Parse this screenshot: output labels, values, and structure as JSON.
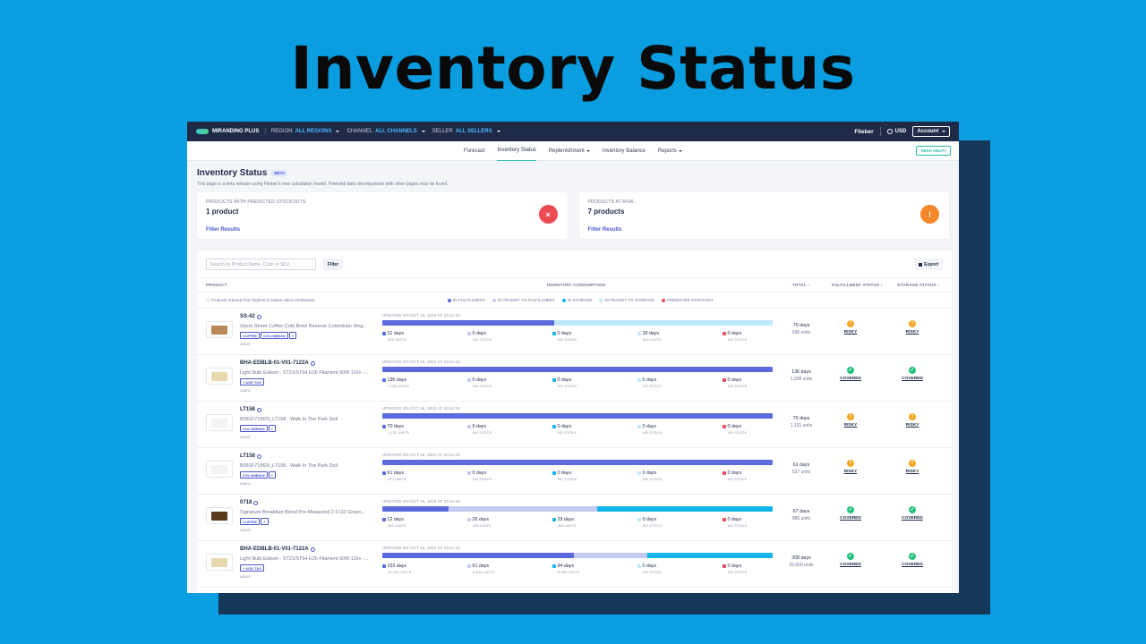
{
  "hero_title": "Inventory Status",
  "colors": {
    "in_fulfillment": "#5b6bde",
    "in_transit_to_fulfillment": "#c5caef",
    "in_storage": "#13b5ea",
    "in_transit_to_storage": "#bfe8fb",
    "predicted_stockout": "#e84a5f",
    "risky": "#f4a623",
    "covered": "#22c07a"
  },
  "topnav": {
    "brand": "MIRANDING PLUS",
    "region_label": "REGION",
    "region_value": "ALL REGIONS",
    "channel_label": "CHANNEL",
    "channel_value": "ALL CHANNELS",
    "seller_label": "SELLER",
    "seller_value": "ALL SELLERS",
    "user": "Flieber",
    "currency": "USD",
    "account": "Account"
  },
  "subnav": {
    "tabs": [
      "Forecast",
      "Inventory Status",
      "Replenishment",
      "Inventory Balance",
      "Reports"
    ],
    "help": "NEED HELP?"
  },
  "page": {
    "title": "Inventory Status",
    "beta": "BETA",
    "notice": "This page is a beta release using Flieber's new calculation model. Potential data discrepancies with other pages may be found."
  },
  "cards": [
    {
      "key": "PRODUCTS WITH PREDICTED STOCKOUTS",
      "value": "1 product",
      "link": "Filter Results",
      "icon": "close-icon",
      "icon_char": "×",
      "color": "#ee4a52"
    },
    {
      "key": "PRODUCTS AT RISK",
      "value": "7 products",
      "link": "Filter Results",
      "icon": "exclamation-icon",
      "icon_char": "!",
      "color": "#f5872b"
    }
  ],
  "toolbar": {
    "search_placeholder": "Search by Product Name, Code or SKU",
    "filter": "Filter",
    "export": "Export"
  },
  "table": {
    "headers": {
      "product": "PRODUCT",
      "consumption": "INVENTORY CONSUMPTION",
      "total": "TOTAL ↕",
      "fulfillment": "FULFILLMENT STATUS ↕",
      "storage": "STORAGE STATUS ↕"
    },
    "order_note": "Products ordered from highest to lowest sales contribution.",
    "legend": [
      "IN FULFILLMENT",
      "IN TRANSIT TO FULFILLMENT",
      "IN STORAGE",
      "IN TRANSIT TO STORAGE",
      "PREDICTED STOCKOUT"
    ],
    "rows": [
      {
        "sku": "SS-42",
        "name": "Stone Street Coffee Cold Brew Reserve Colombian Sing...",
        "tags": [
          "COFFEE",
          "COLOMBIAN",
          "+"
        ],
        "region": "AMUS",
        "updated": "UPDATED ON OCT 16, 2022 AT 23:41:24",
        "segments": [
          0.44,
          0,
          0,
          0.56
        ],
        "thumb_color": "#b88a5a",
        "stats": [
          {
            "days": "31 days",
            "units": "495 UNITS"
          },
          {
            "days": "0 days",
            "units": "NO STOCK"
          },
          {
            "days": "0 days",
            "units": "NO STOCK"
          },
          {
            "days": "39 days",
            "units": "504 UNITS"
          },
          {
            "days": "0 days",
            "units": "NO STOCK"
          }
        ],
        "total_days": "70 days",
        "total_units": "936 units",
        "fulfillment": "RISKY",
        "storage": "RISKY"
      },
      {
        "sku": "BHA-EDBLB-01-V01-7122A",
        "name": "Light Bulb Edison - ST21/ST64 E26 Filament 60W 110v -...",
        "tags": [
          "+ ADD TAG"
        ],
        "region": "AMEU",
        "updated": "UPDATED ON OCT 16, 2022 AT 23:41:22",
        "segments": [
          1,
          0,
          0,
          0
        ],
        "thumb_color": "#e7d8b0",
        "stats": [
          {
            "days": "136 days",
            "units": "1,038 UNITS"
          },
          {
            "days": "0 days",
            "units": "NO STOCK"
          },
          {
            "days": "0 days",
            "units": "NO STOCK"
          },
          {
            "days": "0 days",
            "units": "NO STOCK"
          },
          {
            "days": "0 days",
            "units": "NO STOCK"
          }
        ],
        "total_days": "136 days",
        "total_units": "1,038 units",
        "fulfillment": "COVERED",
        "storage": "COVERED"
      },
      {
        "sku": "LT158",
        "name": "B081F71M29_LT158 - Walk In The Park Doll",
        "tags": [
          "COLOMBIAN",
          "+"
        ],
        "region": "AMUS",
        "updated": "UPDATED ON OCT 16, 2022 AT 23:41:18",
        "segments": [
          1,
          0,
          0,
          0
        ],
        "thumb_color": "#f3f3f3",
        "stats": [
          {
            "days": "70 days",
            "units": "1,131 UNITS"
          },
          {
            "days": "0 days",
            "units": "NO STOCK"
          },
          {
            "days": "0 days",
            "units": "NO STOCK"
          },
          {
            "days": "0 days",
            "units": "NO STOCK"
          },
          {
            "days": "0 days",
            "units": "NO STOCK"
          }
        ],
        "total_days": "70 days",
        "total_units": "1,131 units",
        "fulfillment": "RISKY",
        "storage": "RISKY"
      },
      {
        "sku": "LT158",
        "name": "B081F71M29_LT158 - Walk In The Park Doll",
        "tags": [
          "COLOMBIAN",
          "+"
        ],
        "region": "AMEU",
        "updated": "UPDATED ON OCT 16, 2022 AT 23:41:18",
        "segments": [
          1,
          0,
          0,
          0
        ],
        "thumb_color": "#f3f3f3",
        "stats": [
          {
            "days": "61 days",
            "units": "527 UNITS"
          },
          {
            "days": "0 days",
            "units": "NO STOCK"
          },
          {
            "days": "0 days",
            "units": "NO STOCK"
          },
          {
            "days": "0 days",
            "units": "NO STOCK"
          },
          {
            "days": "0 days",
            "units": "NO STOCK"
          }
        ],
        "total_days": "61 days",
        "total_units": "527 units",
        "fulfillment": "RISKY",
        "storage": "RISKY"
      },
      {
        "sku": "0718",
        "name": "Signature Breakfast Blend Pre-Measured 2.5 OZ Groun...",
        "tags": [
          "COFFEE",
          "+"
        ],
        "region": "AMUS",
        "updated": "UPDATED ON OCT 16, 2022 AT 23:41:19",
        "segments": [
          0.17,
          0.38,
          0.45,
          0
        ],
        "thumb_color": "#5a3b1e",
        "stats": [
          {
            "days": "12 days",
            "units": "155 UNITS"
          },
          {
            "days": "26 days",
            "units": "286 UNITS"
          },
          {
            "days": "29 days",
            "units": "363 UNITS"
          },
          {
            "days": "0 days",
            "units": "NO STOCK"
          },
          {
            "days": "0 days",
            "units": "NO STOCK"
          }
        ],
        "total_days": "67 days",
        "total_units": "889 units",
        "fulfillment": "COVERED",
        "storage": "COVERED"
      },
      {
        "sku": "BHA-EDBLB-01-V01-7122A",
        "name": "Light Bulb Edison - ST21/ST64 E26 Filament 60W 110v -...",
        "tags": [
          "+ ADD TAG"
        ],
        "region": "AMUS",
        "updated": "UPDATED ON OCT 16, 2022 AT 23:41:22",
        "segments": [
          0.49,
          0.19,
          0.32,
          0
        ],
        "thumb_color": "#e7d8b0",
        "stats": [
          {
            "days": "153 days",
            "units": "14,154 UNITS"
          },
          {
            "days": "61 days",
            "units": "5,840 UNITS"
          },
          {
            "days": "94 days",
            "units": "9,095 UNITS"
          },
          {
            "days": "0 days",
            "units": "NO STOCK"
          },
          {
            "days": "0 days",
            "units": "NO STOCK"
          }
        ],
        "total_days": "308 days",
        "total_units": "29,600 units",
        "fulfillment": "COVERED",
        "storage": "COVERED"
      }
    ]
  }
}
